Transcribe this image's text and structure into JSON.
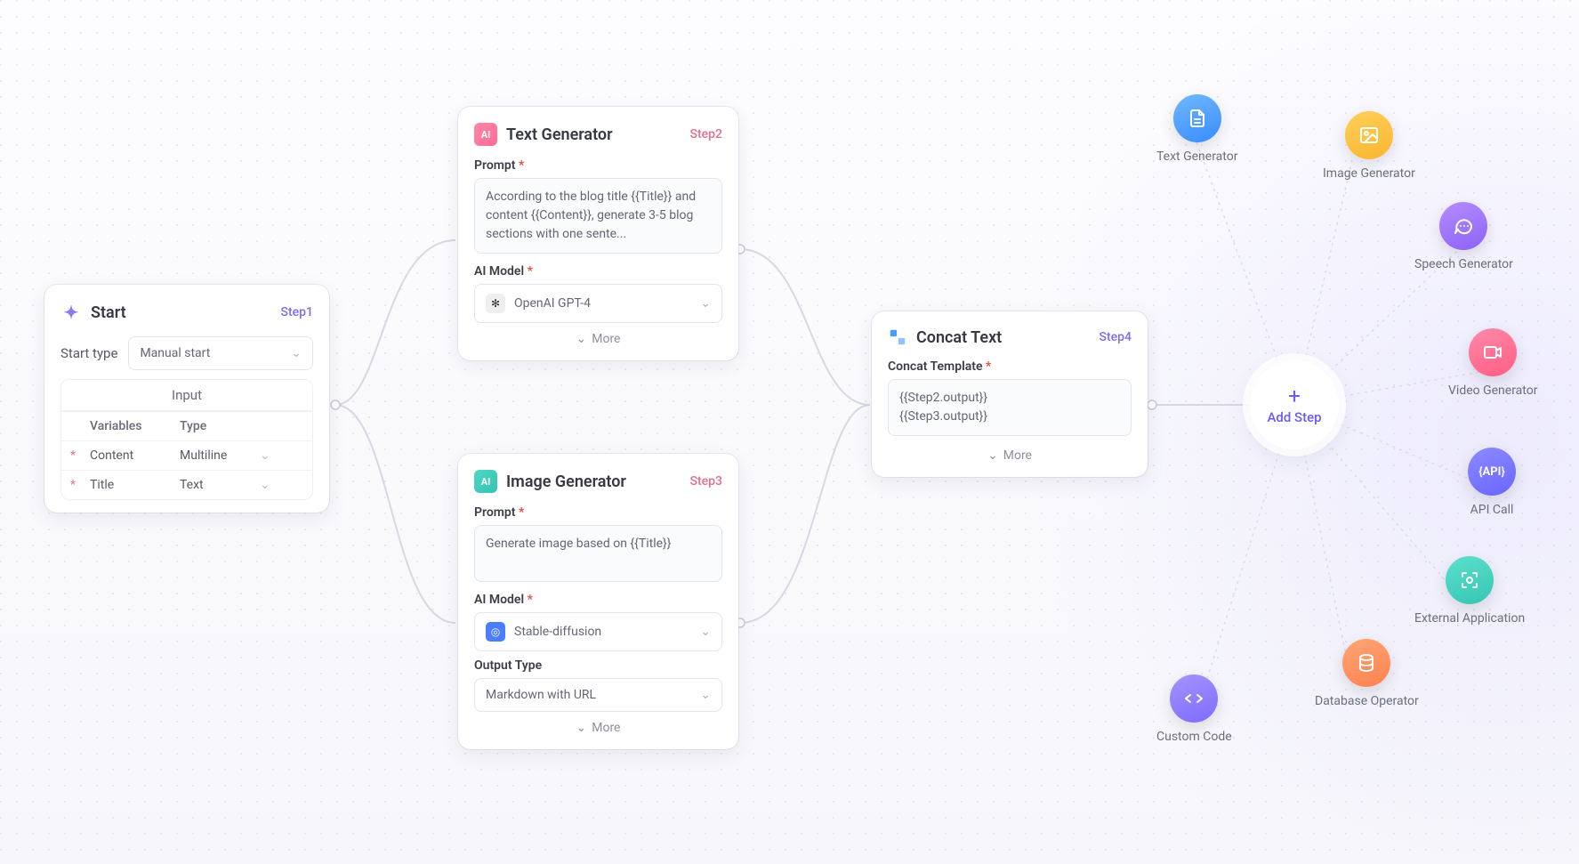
{
  "start": {
    "title": "Start",
    "step_tag": "Step1",
    "start_type_label": "Start type",
    "start_type_value": "Manual start",
    "table": {
      "header": "Input",
      "col_variables": "Variables",
      "col_type": "Type",
      "rows": [
        {
          "var": "Content",
          "type": "Multiline"
        },
        {
          "var": "Title",
          "type": "Text"
        }
      ]
    }
  },
  "text_gen": {
    "badge": "AI",
    "title": "Text Generator",
    "step_tag": "Step2",
    "prompt_label": "Prompt",
    "prompt_value": "According to the blog title {{Title}} and content {{Content}}, generate 3-5 blog sections with one sente...",
    "model_label": "AI Model",
    "model_value": "OpenAI GPT-4",
    "more": "More"
  },
  "image_gen": {
    "badge": "AI",
    "title": "Image Generator",
    "step_tag": "Step3",
    "prompt_label": "Prompt",
    "prompt_value": "Generate image based on {{Title}}",
    "model_label": "AI Model",
    "model_value": "Stable-diffusion",
    "output_type_label": "Output Type",
    "output_type_value": "Markdown with URL",
    "more": "More"
  },
  "concat": {
    "title": "Concat Text",
    "step_tag": "Step4",
    "template_label": "Concat Template",
    "template_value": "{{Step2.output}}\n{{Step3.output}}",
    "more": "More"
  },
  "add_step": {
    "label": "Add Step"
  },
  "tools": {
    "text_generator": "Text Generator",
    "image_generator": "Image Generator",
    "speech_generator": "Speech Generator",
    "video_generator": "Video Generator",
    "api_call": "API Call",
    "external_app": "External Application",
    "database_operator": "Database Operator",
    "custom_code": "Custom Code"
  }
}
